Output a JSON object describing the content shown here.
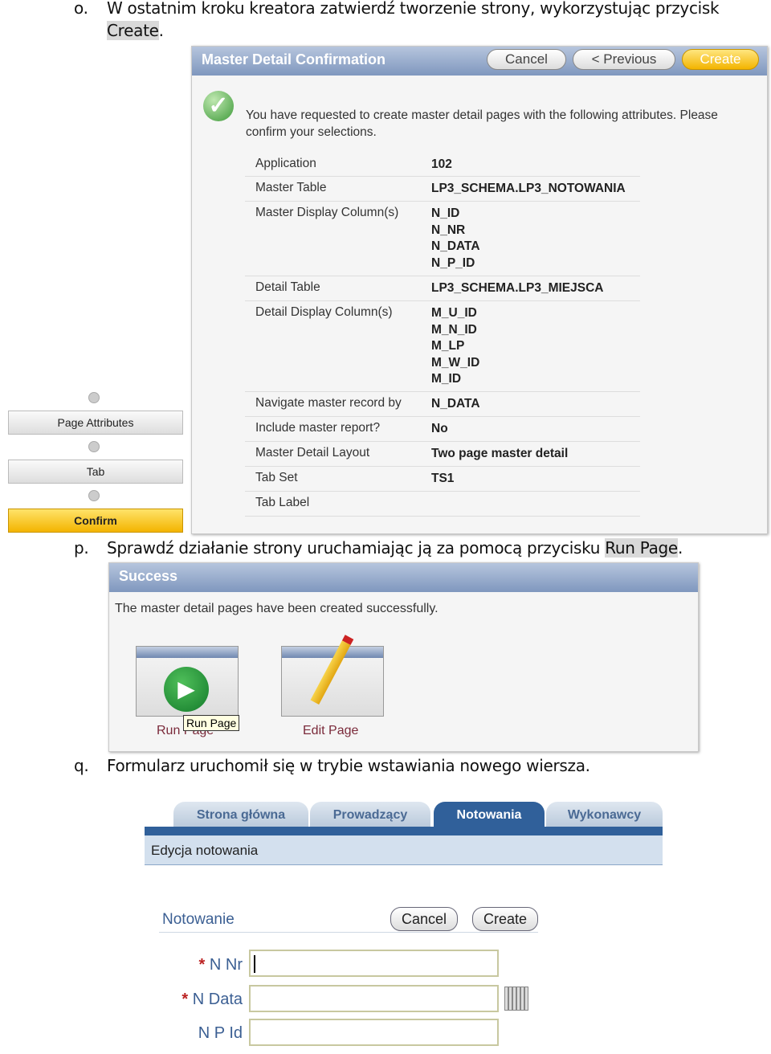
{
  "step_o": {
    "marker": "o.",
    "text": "W ostatnim kroku kreatora zatwierdź tworzenie strony, wykorzystując przycisk",
    "highlight": "Create",
    "suffix": "."
  },
  "confirm_panel": {
    "title": "Master Detail Confirmation",
    "buttons": {
      "cancel": "Cancel",
      "previous": "< Previous",
      "create": "Create"
    },
    "intro": "You have requested to create master detail pages with the following attributes. Please confirm your selections.",
    "rows": [
      {
        "label": "Application",
        "value": "102"
      },
      {
        "label": "Master Table",
        "value": "LP3_SCHEMA.LP3_NOTOWANIA"
      },
      {
        "label": "Master Display Column(s)",
        "values": [
          "N_ID",
          "N_NR",
          "N_DATA",
          "N_P_ID"
        ]
      },
      {
        "label": "Detail Table",
        "value": "LP3_SCHEMA.LP3_MIEJSCA"
      },
      {
        "label": "Detail Display Column(s)",
        "values": [
          "M_U_ID",
          "M_N_ID",
          "M_LP",
          "M_W_ID",
          "M_ID"
        ]
      },
      {
        "label": "Navigate master record by",
        "value": "N_DATA"
      },
      {
        "label": "Include master report?",
        "value": "No"
      },
      {
        "label": "Master Detail Layout",
        "value": "Two page master detail"
      },
      {
        "label": "Tab Set",
        "value": "TS1"
      },
      {
        "label": "Tab Label",
        "value": ""
      }
    ]
  },
  "wizard_steps": [
    "Page Attributes",
    "Tab",
    "Confirm"
  ],
  "step_p": {
    "marker": "p.",
    "text": "Sprawdź działanie strony uruchamiając ją za pomocą przycisku",
    "highlight": "Run Page",
    "suffix": "."
  },
  "success_panel": {
    "title": "Success",
    "message": "The master detail pages have been created successfully.",
    "run_label": "Run Page",
    "edit_label": "Edit Page",
    "tooltip": "Run Page"
  },
  "step_q": {
    "marker": "q.",
    "text": "Formularz uruchomił się w trybie wstawiania nowego wiersza."
  },
  "app": {
    "tabs": [
      "Strona główna",
      "Prowadzący",
      "Notowania",
      "Wykonawcy"
    ],
    "active_tab": "Notowania",
    "breadcrumb": "Edycja notowania",
    "region_title": "Notowanie",
    "cancel": "Cancel",
    "create": "Create",
    "fields": [
      {
        "label": "N Nr",
        "required": true,
        "value": ""
      },
      {
        "label": "N Data",
        "required": true,
        "value": ""
      },
      {
        "label": "N P Id",
        "required": false,
        "value": ""
      }
    ],
    "required_mark": "*"
  }
}
